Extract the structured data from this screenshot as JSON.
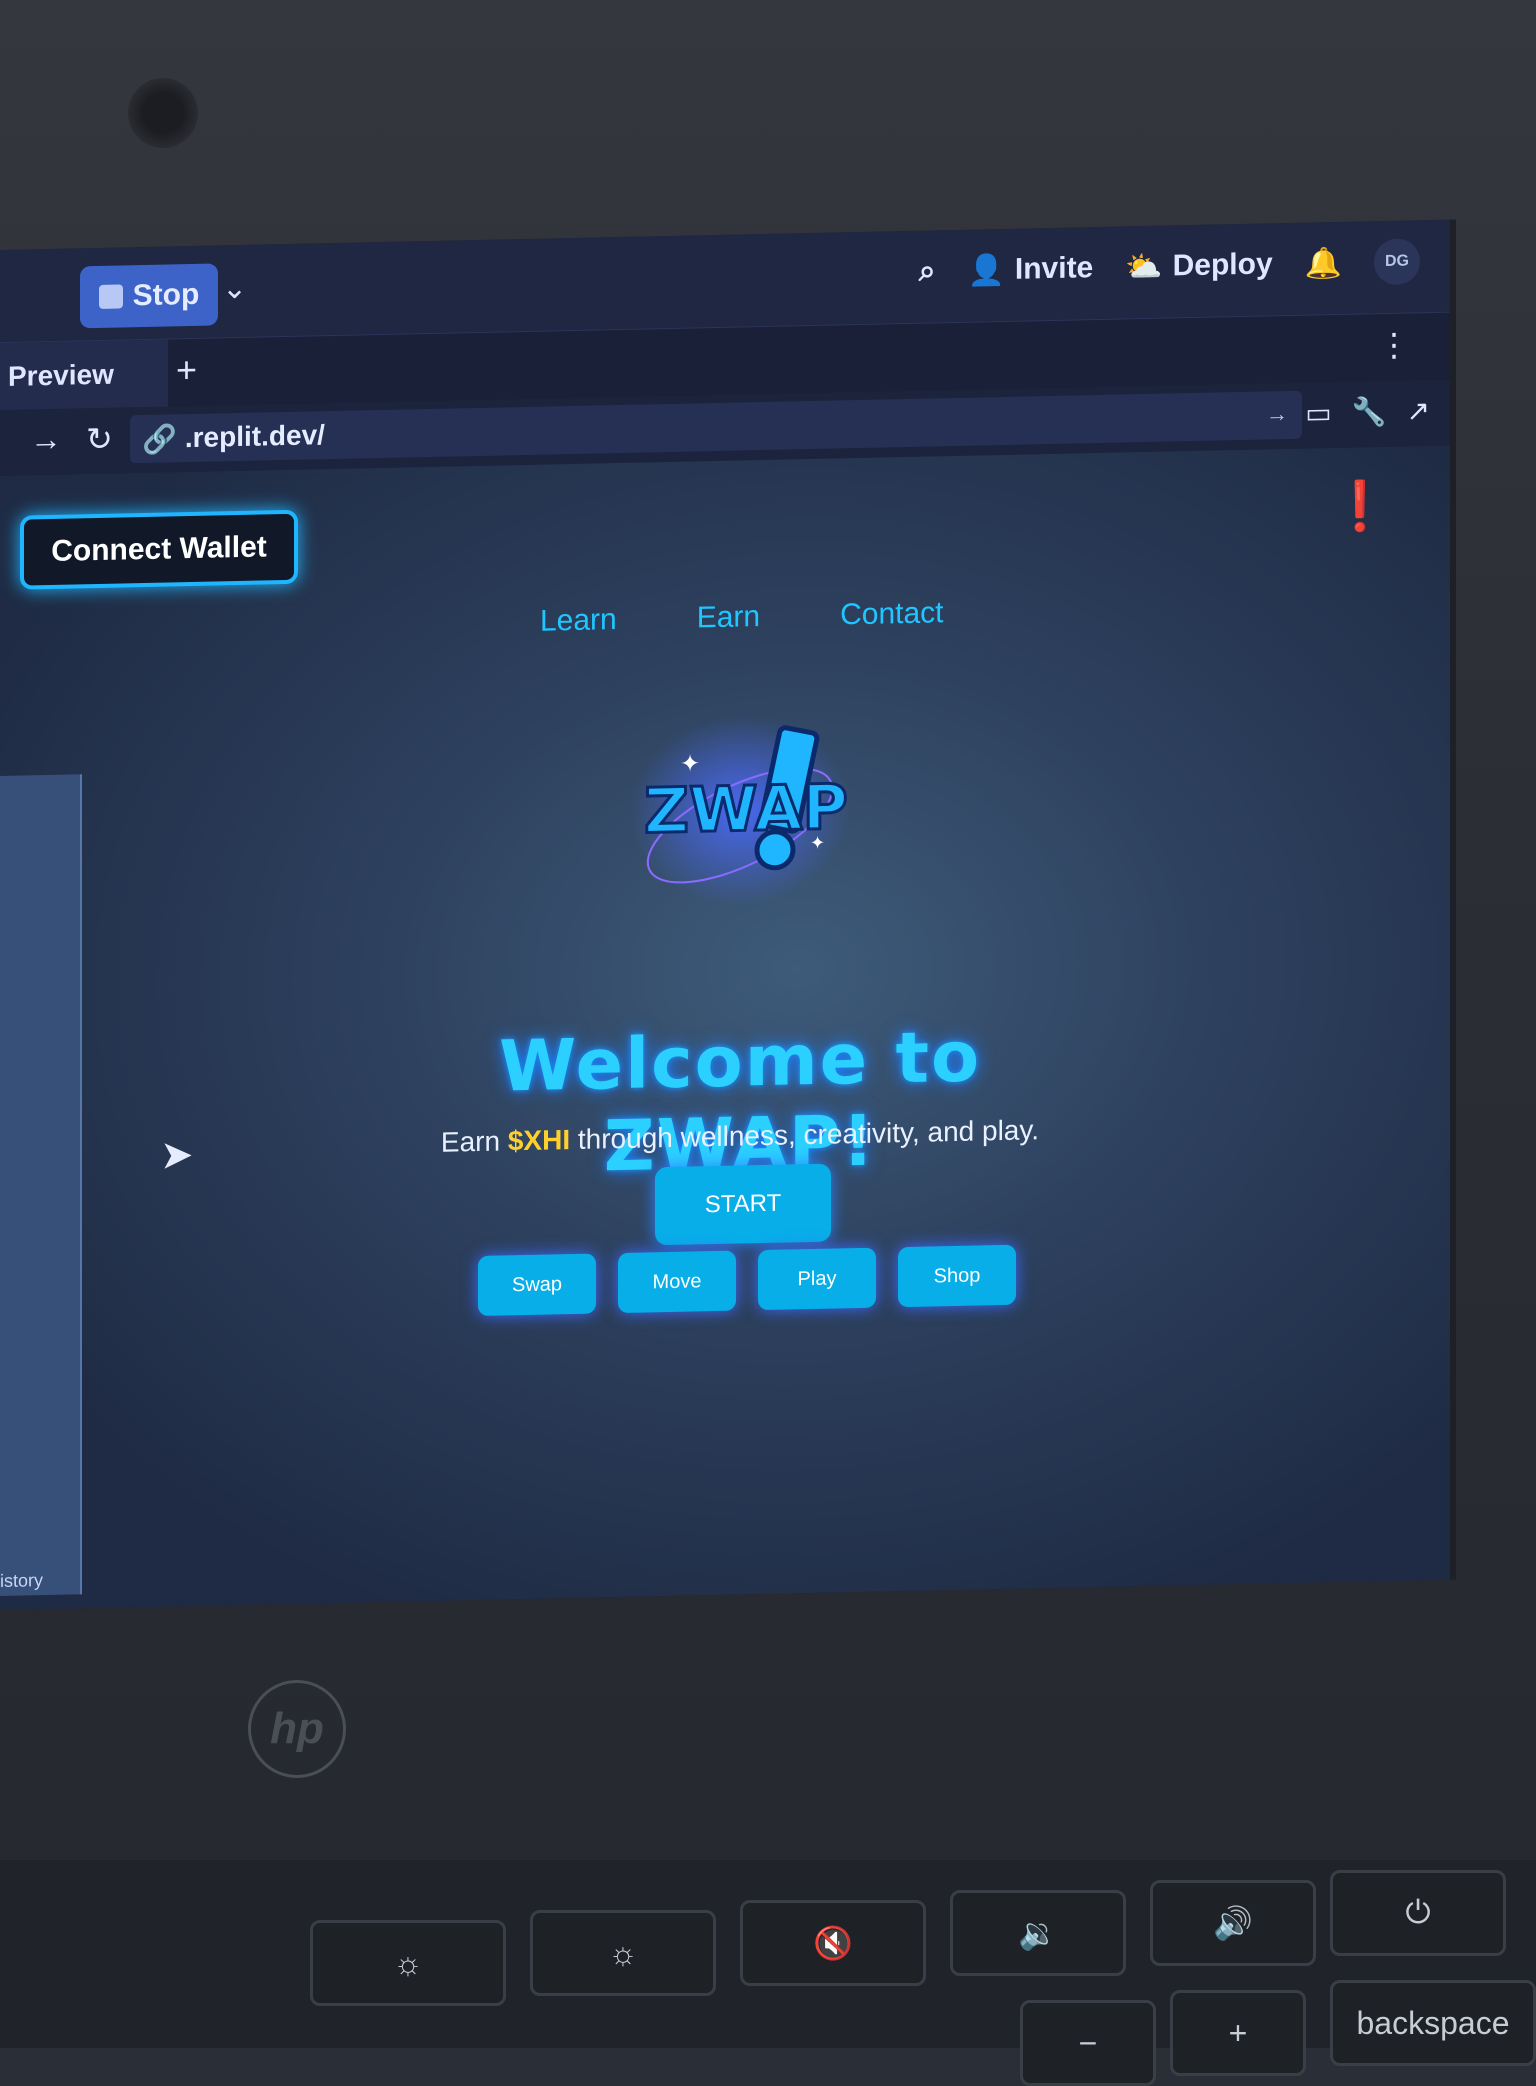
{
  "topbar": {
    "stop_label": "Stop",
    "invite_label": "Invite",
    "deploy_label": "Deploy",
    "avatar_initials": "DG"
  },
  "tabs": {
    "preview_label": "Preview",
    "add_label": "+"
  },
  "address": {
    "url": ".replit.dev/"
  },
  "page": {
    "connect_wallet_label": "Connect Wallet",
    "nav": [
      "Learn",
      "Earn",
      "Contact"
    ],
    "logo_text": "ZWAP!",
    "headline": "Welcome to ZWAP!",
    "tagline_pre": "Earn ",
    "tagline_highlight": "$XHI",
    "tagline_post": " through wellness, creativity, and play.",
    "start_label": "START",
    "actions": [
      "Swap",
      "Move",
      "Play",
      "Shop"
    ],
    "history_label": "istory"
  },
  "laptop": {
    "brand": "hp",
    "keys": [
      "backspace",
      "+",
      "−"
    ]
  },
  "colors": {
    "accent": "#08aee8",
    "headline": "#2bd0ff",
    "highlight": "#ffd02b"
  }
}
